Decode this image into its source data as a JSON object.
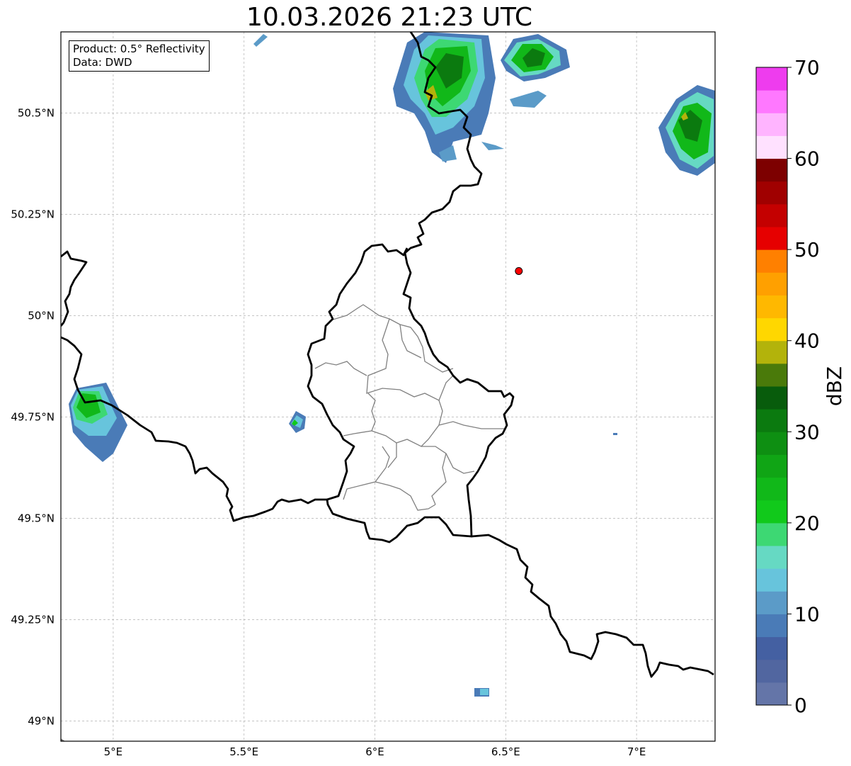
{
  "title": "10.03.2026 21:23 UTC",
  "info_box": {
    "product": "Product: 0.5° Reflectivity",
    "data": "Data: DWD"
  },
  "map": {
    "lon_range": [
      4.8,
      7.3
    ],
    "lat_range": [
      48.95,
      50.7
    ],
    "gridlines": true,
    "lon_ticks": [
      {
        "value": 5.0,
        "label": "5°E"
      },
      {
        "value": 5.5,
        "label": "5.5°E"
      },
      {
        "value": 6.0,
        "label": "6°E"
      },
      {
        "value": 6.5,
        "label": "6.5°E"
      },
      {
        "value": 7.0,
        "label": "7°E"
      }
    ],
    "lat_ticks": [
      {
        "value": 50.5,
        "label": "50.5°N"
      },
      {
        "value": 50.25,
        "label": "50.25°N"
      },
      {
        "value": 50.0,
        "label": "50°N"
      },
      {
        "value": 49.75,
        "label": "49.75°N"
      },
      {
        "value": 49.5,
        "label": "49.5°N"
      },
      {
        "value": 49.25,
        "label": "49.25°N"
      },
      {
        "value": 49.0,
        "label": "49°N"
      }
    ],
    "radar_site": {
      "lon": 6.55,
      "lat": 50.11,
      "color": "#ff0000"
    }
  },
  "colorbar": {
    "label": "dBZ",
    "min": 0,
    "max": 70,
    "ticks": [
      "0",
      "10",
      "20",
      "30",
      "40",
      "50",
      "60",
      "70"
    ],
    "colors": [
      "#6475a8",
      "#5166a0",
      "#4460a2",
      "#4a7bb7",
      "#5b9bc8",
      "#67c4dc",
      "#66d9c3",
      "#3dd873",
      "#11c91b",
      "#11b819",
      "#10a515",
      "#0e8f12",
      "#0b7a0f",
      "#085c0c",
      "#4a7a0a",
      "#b3b30b",
      "#ffd700",
      "#ffb800",
      "#ffa000",
      "#ff8000",
      "#e60000",
      "#c40000",
      "#a00000",
      "#7d0000",
      "#ffe1ff",
      "#ffb4ff",
      "#ff78ff",
      "#ee3cee"
    ]
  },
  "precip_cells": [
    {
      "name": "cell-north-center",
      "lon": 6.3,
      "lat": 50.57,
      "dbz_core": 25
    },
    {
      "name": "cell-north-east",
      "lon": 6.6,
      "lat": 50.62,
      "dbz_core": 28
    },
    {
      "name": "cell-far-east",
      "lon": 7.2,
      "lat": 50.47,
      "dbz_core": 30
    },
    {
      "name": "cell-west",
      "lon": 4.88,
      "lat": 49.77,
      "dbz_core": 22
    },
    {
      "name": "cell-small-center",
      "lon": 5.71,
      "lat": 49.74,
      "dbz_core": 18
    },
    {
      "name": "cell-south",
      "lon": 6.42,
      "lat": 49.07,
      "dbz_core": 12
    }
  ]
}
